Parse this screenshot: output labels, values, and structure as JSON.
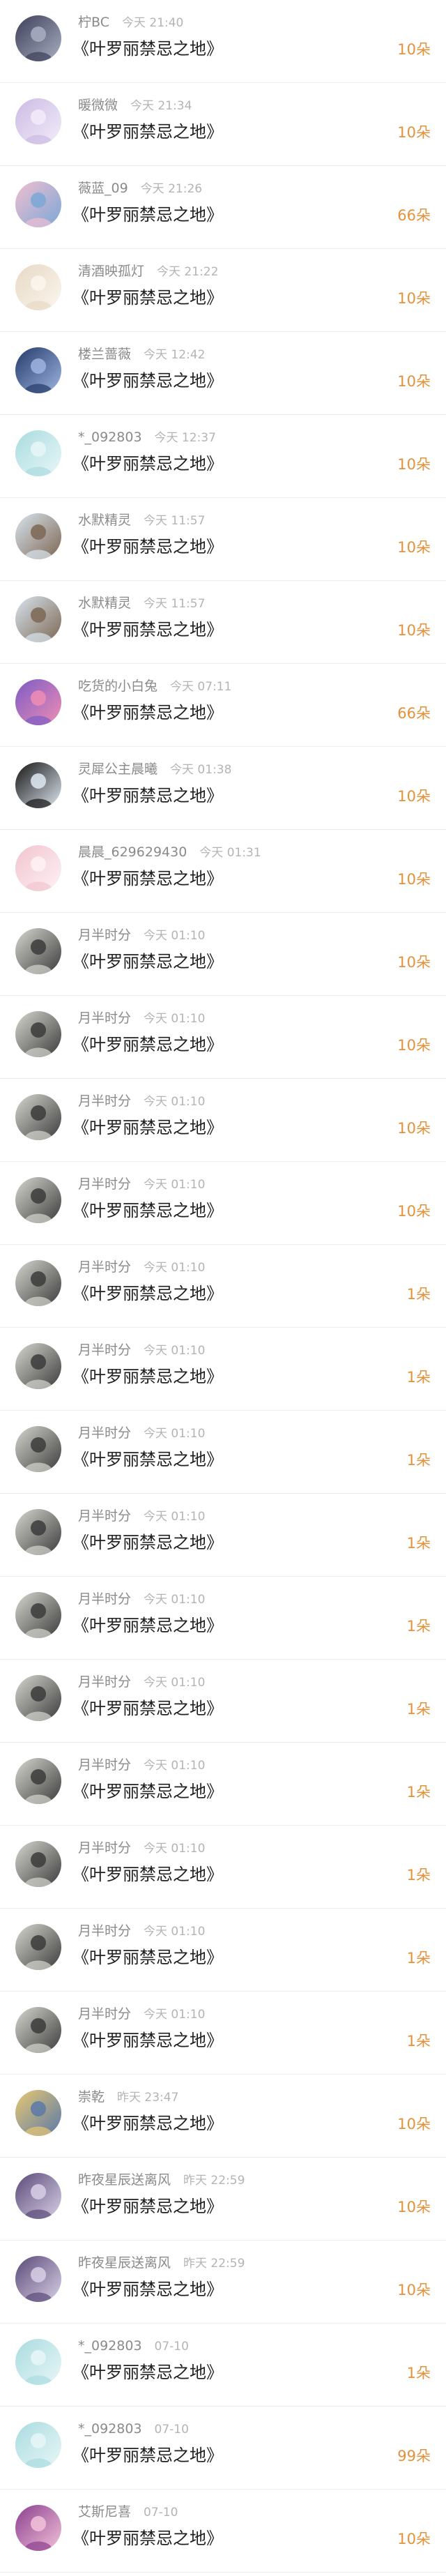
{
  "gift_records": [
    {
      "user": "柠BC",
      "time": "今天 21:40",
      "gift": "《叶罗丽禁忌之地》",
      "count": "10朵",
      "avatar": {
        "icon": "avatar-dark-character",
        "colors": [
          "#3c3f58",
          "#a9aec2"
        ]
      }
    },
    {
      "user": "暖微微",
      "time": "今天 21:34",
      "gift": "《叶罗丽禁忌之地》",
      "count": "10朵",
      "avatar": {
        "icon": "avatar-fairy",
        "colors": [
          "#cbbbe3",
          "#f3ecfa"
        ]
      }
    },
    {
      "user": "薇蓝_09",
      "time": "今天 21:26",
      "gift": "《叶罗丽禁忌之地》",
      "count": "66朵",
      "avatar": {
        "icon": "avatar-anime-girl",
        "colors": [
          "#f0bfd0",
          "#7ba7d6"
        ]
      }
    },
    {
      "user": "清酒映孤灯",
      "time": "今天 21:22",
      "gift": "《叶罗丽禁忌之地》",
      "count": "10朵",
      "avatar": {
        "icon": "avatar-light-figure",
        "colors": [
          "#e7d9c4",
          "#fbf6ee"
        ]
      }
    },
    {
      "user": "楼兰蔷薇",
      "time": "今天 12:42",
      "gift": "《叶罗丽禁忌之地》",
      "count": "10朵",
      "avatar": {
        "icon": "avatar-night-character",
        "colors": [
          "#233a6b",
          "#9fb4e0"
        ]
      }
    },
    {
      "user": "*_092803",
      "time": "今天 12:37",
      "gift": "《叶罗丽禁忌之地》",
      "count": "10朵",
      "avatar": {
        "icon": "avatar-cyan-character",
        "colors": [
          "#a9dce0",
          "#e8f6f7"
        ]
      }
    },
    {
      "user": "水默精灵",
      "time": "今天 11:57",
      "gift": "《叶罗丽禁忌之地》",
      "count": "10朵",
      "avatar": {
        "icon": "avatar-chibi-pair",
        "colors": [
          "#d8e5ef",
          "#7d6652"
        ]
      }
    },
    {
      "user": "水默精灵",
      "time": "今天 11:57",
      "gift": "《叶罗丽禁忌之地》",
      "count": "10朵",
      "avatar": {
        "icon": "avatar-chibi-pair",
        "colors": [
          "#d8e5ef",
          "#7d6652"
        ]
      }
    },
    {
      "user": "吃货的小白兔",
      "time": "今天 07:11",
      "gift": "《叶罗丽禁忌之地》",
      "count": "66朵",
      "avatar": {
        "icon": "avatar-colorful-character",
        "colors": [
          "#7b5cc6",
          "#f08db4"
        ]
      }
    },
    {
      "user": "灵犀公主晨曦",
      "time": "今天 01:38",
      "gift": "《叶罗丽禁忌之地》",
      "count": "10朵",
      "avatar": {
        "icon": "avatar-dancer",
        "colors": [
          "#141414",
          "#dfe8f2"
        ]
      }
    },
    {
      "user": "晨晨_629629430",
      "time": "今天 01:31",
      "gift": "《叶罗丽禁忌之地》",
      "count": "10朵",
      "avatar": {
        "icon": "avatar-pink-character",
        "colors": [
          "#f1c4cf",
          "#fff2f5"
        ]
      }
    },
    {
      "user": "月半时分",
      "time": "今天 01:10",
      "gift": "《叶罗丽禁忌之地》",
      "count": "10朵",
      "avatar": {
        "icon": "avatar-ink-character",
        "colors": [
          "#d7d7d0",
          "#3b3b3b"
        ]
      }
    },
    {
      "user": "月半时分",
      "time": "今天 01:10",
      "gift": "《叶罗丽禁忌之地》",
      "count": "10朵",
      "avatar": {
        "icon": "avatar-ink-character",
        "colors": [
          "#d7d7d0",
          "#3b3b3b"
        ]
      }
    },
    {
      "user": "月半时分",
      "time": "今天 01:10",
      "gift": "《叶罗丽禁忌之地》",
      "count": "10朵",
      "avatar": {
        "icon": "avatar-ink-character",
        "colors": [
          "#d7d7d0",
          "#3b3b3b"
        ]
      }
    },
    {
      "user": "月半时分",
      "time": "今天 01:10",
      "gift": "《叶罗丽禁忌之地》",
      "count": "10朵",
      "avatar": {
        "icon": "avatar-ink-character",
        "colors": [
          "#d7d7d0",
          "#3b3b3b"
        ]
      }
    },
    {
      "user": "月半时分",
      "time": "今天 01:10",
      "gift": "《叶罗丽禁忌之地》",
      "count": "1朵",
      "avatar": {
        "icon": "avatar-ink-character",
        "colors": [
          "#d7d7d0",
          "#3b3b3b"
        ]
      }
    },
    {
      "user": "月半时分",
      "time": "今天 01:10",
      "gift": "《叶罗丽禁忌之地》",
      "count": "1朵",
      "avatar": {
        "icon": "avatar-ink-character",
        "colors": [
          "#d7d7d0",
          "#3b3b3b"
        ]
      }
    },
    {
      "user": "月半时分",
      "time": "今天 01:10",
      "gift": "《叶罗丽禁忌之地》",
      "count": "1朵",
      "avatar": {
        "icon": "avatar-ink-character",
        "colors": [
          "#d7d7d0",
          "#3b3b3b"
        ]
      }
    },
    {
      "user": "月半时分",
      "time": "今天 01:10",
      "gift": "《叶罗丽禁忌之地》",
      "count": "1朵",
      "avatar": {
        "icon": "avatar-ink-character",
        "colors": [
          "#d7d7d0",
          "#3b3b3b"
        ]
      }
    },
    {
      "user": "月半时分",
      "time": "今天 01:10",
      "gift": "《叶罗丽禁忌之地》",
      "count": "1朵",
      "avatar": {
        "icon": "avatar-ink-character",
        "colors": [
          "#d7d7d0",
          "#3b3b3b"
        ]
      }
    },
    {
      "user": "月半时分",
      "time": "今天 01:10",
      "gift": "《叶罗丽禁忌之地》",
      "count": "1朵",
      "avatar": {
        "icon": "avatar-ink-character",
        "colors": [
          "#d7d7d0",
          "#3b3b3b"
        ]
      }
    },
    {
      "user": "月半时分",
      "time": "今天 01:10",
      "gift": "《叶罗丽禁忌之地》",
      "count": "1朵",
      "avatar": {
        "icon": "avatar-ink-character",
        "colors": [
          "#d7d7d0",
          "#3b3b3b"
        ]
      }
    },
    {
      "user": "月半时分",
      "time": "今天 01:10",
      "gift": "《叶罗丽禁忌之地》",
      "count": "1朵",
      "avatar": {
        "icon": "avatar-ink-character",
        "colors": [
          "#d7d7d0",
          "#3b3b3b"
        ]
      }
    },
    {
      "user": "月半时分",
      "time": "今天 01:10",
      "gift": "《叶罗丽禁忌之地》",
      "count": "1朵",
      "avatar": {
        "icon": "avatar-ink-character",
        "colors": [
          "#d7d7d0",
          "#3b3b3b"
        ]
      }
    },
    {
      "user": "月半时分",
      "time": "今天 01:10",
      "gift": "《叶罗丽禁忌之地》",
      "count": "1朵",
      "avatar": {
        "icon": "avatar-ink-character",
        "colors": [
          "#d7d7d0",
          "#3b3b3b"
        ]
      }
    },
    {
      "user": "崇乾",
      "time": "昨天 23:47",
      "gift": "《叶罗丽禁忌之地》",
      "count": "10朵",
      "avatar": {
        "icon": "avatar-blonde-character",
        "colors": [
          "#e8c873",
          "#5a79a8"
        ]
      }
    },
    {
      "user": "昨夜星辰送离风",
      "time": "昨天 22:59",
      "gift": "《叶罗丽禁忌之地》",
      "count": "10朵",
      "avatar": {
        "icon": "avatar-purple-character",
        "colors": [
          "#5a4a78",
          "#d9cfe6"
        ]
      }
    },
    {
      "user": "昨夜星辰送离风",
      "time": "昨天 22:59",
      "gift": "《叶罗丽禁忌之地》",
      "count": "10朵",
      "avatar": {
        "icon": "avatar-purple-character",
        "colors": [
          "#5a4a78",
          "#d9cfe6"
        ]
      }
    },
    {
      "user": "*_092803",
      "time": "07-10",
      "gift": "《叶罗丽禁忌之地》",
      "count": "1朵",
      "avatar": {
        "icon": "avatar-cyan-character",
        "colors": [
          "#a9dce0",
          "#e8f6f7"
        ]
      }
    },
    {
      "user": "*_092803",
      "time": "07-10",
      "gift": "《叶罗丽禁忌之地》",
      "count": "99朵",
      "avatar": {
        "icon": "avatar-cyan-character",
        "colors": [
          "#a9dce0",
          "#e8f6f7"
        ]
      }
    },
    {
      "user": "艾斯尼喜",
      "time": "07-10",
      "gift": "《叶罗丽禁忌之地》",
      "count": "10朵",
      "avatar": {
        "icon": "avatar-bright-character",
        "colors": [
          "#8b3f8f",
          "#f3c2d9"
        ]
      }
    }
  ]
}
